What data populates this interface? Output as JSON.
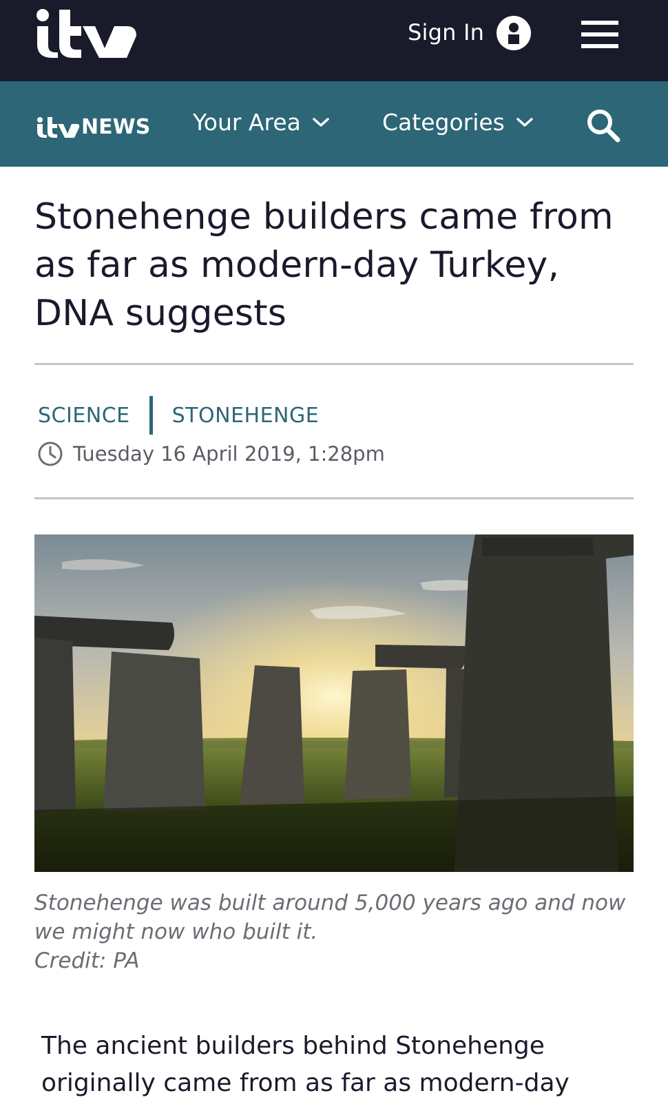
{
  "header": {
    "brand": "itv",
    "sign_in_label": "Sign In",
    "icons": {
      "user": "user-icon",
      "menu": "hamburger-menu-icon"
    }
  },
  "news_nav": {
    "brand": "NEWS",
    "your_area_label": "Your Area",
    "categories_label": "Categories",
    "icons": {
      "dropdown": "chevron-down-icon",
      "search": "search-icon"
    }
  },
  "article": {
    "headline": "Stonehenge builders came from as far as modern-day Turkey, DNA suggests",
    "tags": [
      "SCIENCE",
      "STONEHENGE"
    ],
    "timestamp": "Tuesday 16 April 2019, 1:28pm",
    "image_caption_line1": "Stonehenge was built around 5,000 years ago and now we might now who built it.",
    "image_credit": "Credit: PA",
    "lead_paragraph": "The ancient builders behind Stonehenge originally came from as far as modern-day"
  },
  "colors": {
    "top_bar": "#191b2b",
    "news_bar": "#2c6677",
    "accent": "#2c6677",
    "text": "#1a1a2c",
    "muted": "#6c6c74"
  }
}
